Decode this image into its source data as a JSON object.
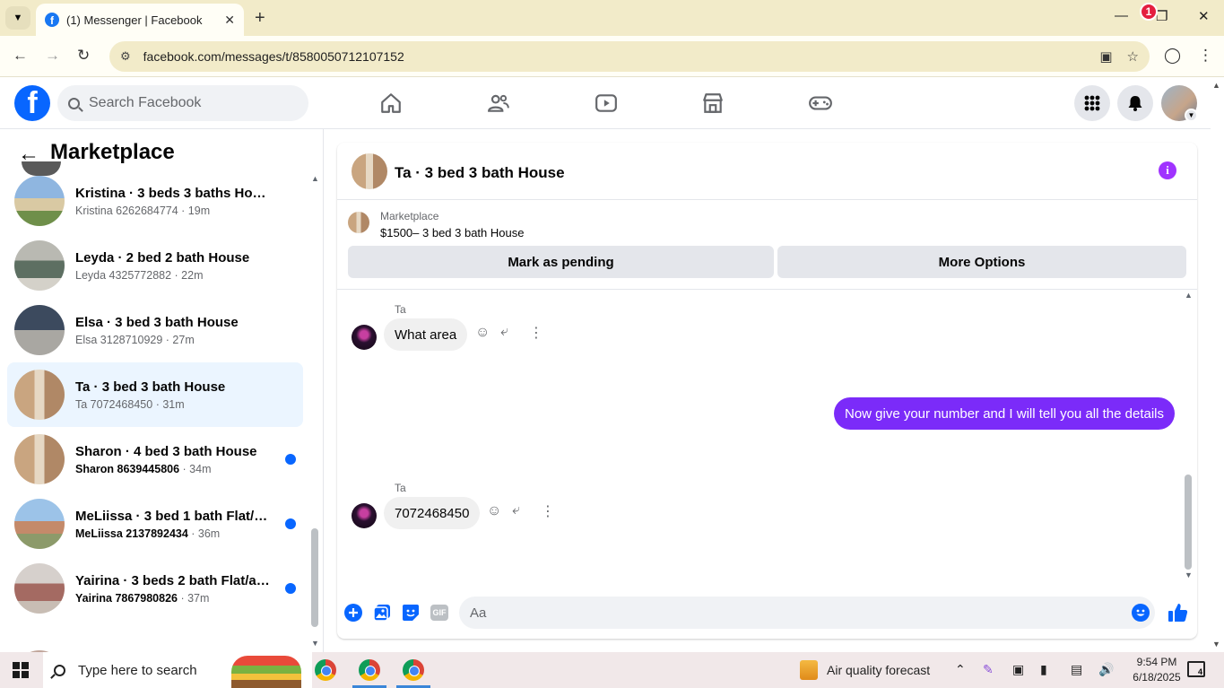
{
  "browser": {
    "tab_title": "(1) Messenger | Facebook",
    "url": "facebook.com/messages/t/8580050712107152"
  },
  "header": {
    "search_placeholder": "Search Facebook",
    "notification_count": "1",
    "brand_color": "#0866ff",
    "badge_color": "#e41e3f"
  },
  "sidebar": {
    "title": "Marketplace",
    "conversations": [
      {
        "title": "Kristina · 3 beds 3 baths House",
        "subtitle": "Kristina 6262684774",
        "time": "· 19m",
        "unread": false,
        "active": false
      },
      {
        "title": "Leyda · 2 bed 2 bath House",
        "subtitle": "Leyda 4325772882",
        "time": "· 22m",
        "unread": false,
        "active": false
      },
      {
        "title": "Elsa · 3 bed 3 bath House",
        "subtitle": "Elsa 3128710929",
        "time": "· 27m",
        "unread": false,
        "active": false
      },
      {
        "title": "Ta · 3 bed 3 bath House",
        "subtitle": "Ta 7072468450",
        "time": "· 31m",
        "unread": false,
        "active": true
      },
      {
        "title": "Sharon · 4 bed 3 bath House",
        "subtitle": "Sharon 8639445806",
        "time": " · 34m",
        "unread": true,
        "active": false
      },
      {
        "title": "MeLiissa · 3 bed 1 bath Flat/ap...",
        "subtitle": "MeLiissa 2137892434",
        "time": " · 36m",
        "unread": true,
        "active": false
      },
      {
        "title": "Yairina · 3 beds 2 bath Flat/ap...",
        "subtitle": "Yairina 7867980826",
        "time": " · 37m",
        "unread": true,
        "active": false
      }
    ]
  },
  "chat": {
    "title": "Ta · 3 bed 3 bath House",
    "marketplace_label": "Marketplace",
    "listing": "$1500– 3 bed 3 bath House",
    "mark_pending": "Mark as pending",
    "more_options": "More Options",
    "messages": [
      {
        "sender": "Ta",
        "text": "What area",
        "direction": "in"
      },
      {
        "sender": "",
        "text": "Now give your number and I will tell you all the details",
        "direction": "out"
      },
      {
        "sender": "Ta",
        "text": "7072468450",
        "direction": "in"
      }
    ],
    "composer_placeholder": "Aa",
    "gif_label": "GIF",
    "outgoing_color": "#7b2bf9",
    "accent_color": "#0866ff"
  },
  "taskbar": {
    "search_placeholder": "Type here to search",
    "weather": "Air quality forecast",
    "time": "9:54 PM",
    "date": "6/18/2025",
    "notifications": "4"
  }
}
